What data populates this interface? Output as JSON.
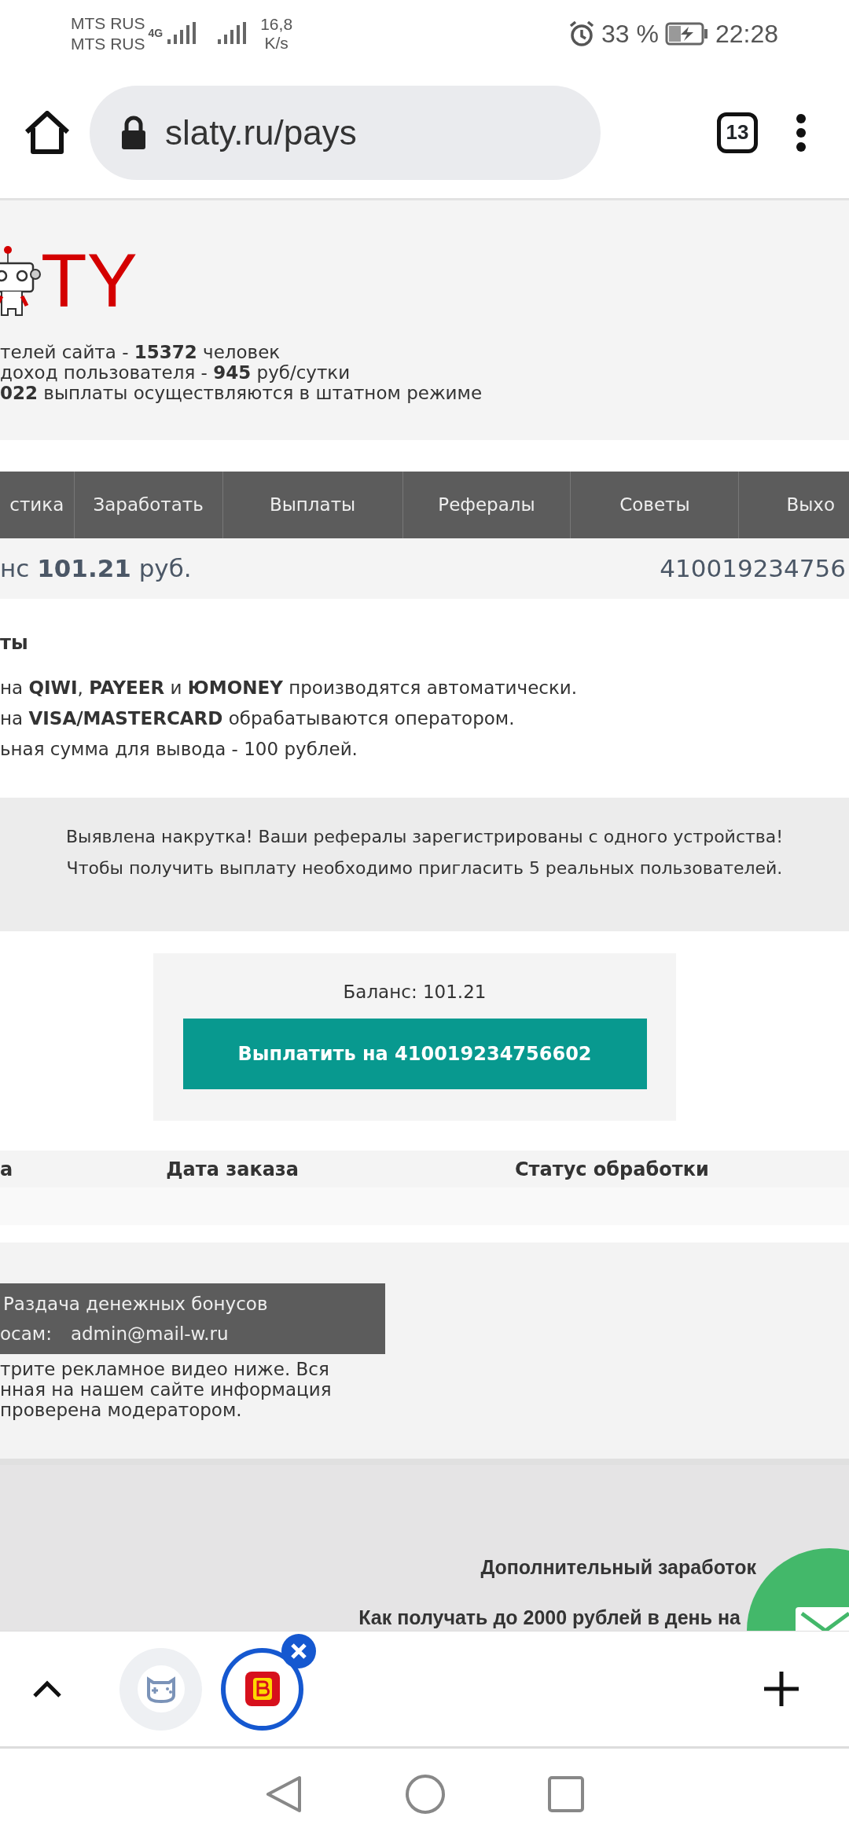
{
  "status_bar": {
    "carrier_1": "MTS RUS",
    "carrier_2": "MTS RUS",
    "network_type": "4G",
    "speed": "16,8",
    "speed_unit": "K/s",
    "battery": "33 %",
    "time": "22:28"
  },
  "browser": {
    "url": "slaty.ru/pays",
    "tab_count": "13"
  },
  "site": {
    "logo_text": "TY",
    "stats": [
      "телей сайта - **15372** человек",
      "доход пользователя - **945** руб/сутки",
      "**022** выплаты осуществляются в штатном режиме"
    ],
    "nav": [
      "стика",
      "Заработать",
      "Выплаты",
      "Рефералы",
      "Советы",
      "Выхо"
    ],
    "balance_bar": {
      "balance": "нс **101.21** руб.",
      "wallet": "410019234756"
    },
    "payouts": {
      "title": "ты",
      "lines": [
        "на **QIWI**, **PAYEER** и **ЮMONEY** производятся автоматически.",
        "на **VISA/MASTERCARD** обрабатываются оператором.",
        "ьная сумма для вывода - 100 рублей."
      ]
    },
    "alert": {
      "lines": [
        "Выявлена накрутка! Ваши рефералы зарегистрированы с одного устройства!",
        "Чтобы получить выплату необходимо пригласить 5 реальных пользователей."
      ]
    },
    "payout_box": {
      "balance": "Баланс: 101.21",
      "button": "Выплатить на 410019234756602"
    },
    "table": {
      "columns": [
        "а",
        "Дата заказа",
        "Статус обработки"
      ]
    },
    "footer": {
      "banner": "Раздача денежных бонусов",
      "contact_label": "осам:",
      "contact_email": "admin@mail-w.ru",
      "note_lines": [
        "трите рекламное видео ниже. Вся",
        "нная на нашем сайте информация",
        "проверена модератором."
      ]
    },
    "extra": {
      "title": "Дополнительный заработок",
      "link": "Как получать до 2000 рублей в день на"
    }
  },
  "bottom_bar": {
    "tabs": [
      {
        "kind": "game",
        "selected": false
      },
      {
        "kind": "letter",
        "selected": true
      }
    ]
  }
}
